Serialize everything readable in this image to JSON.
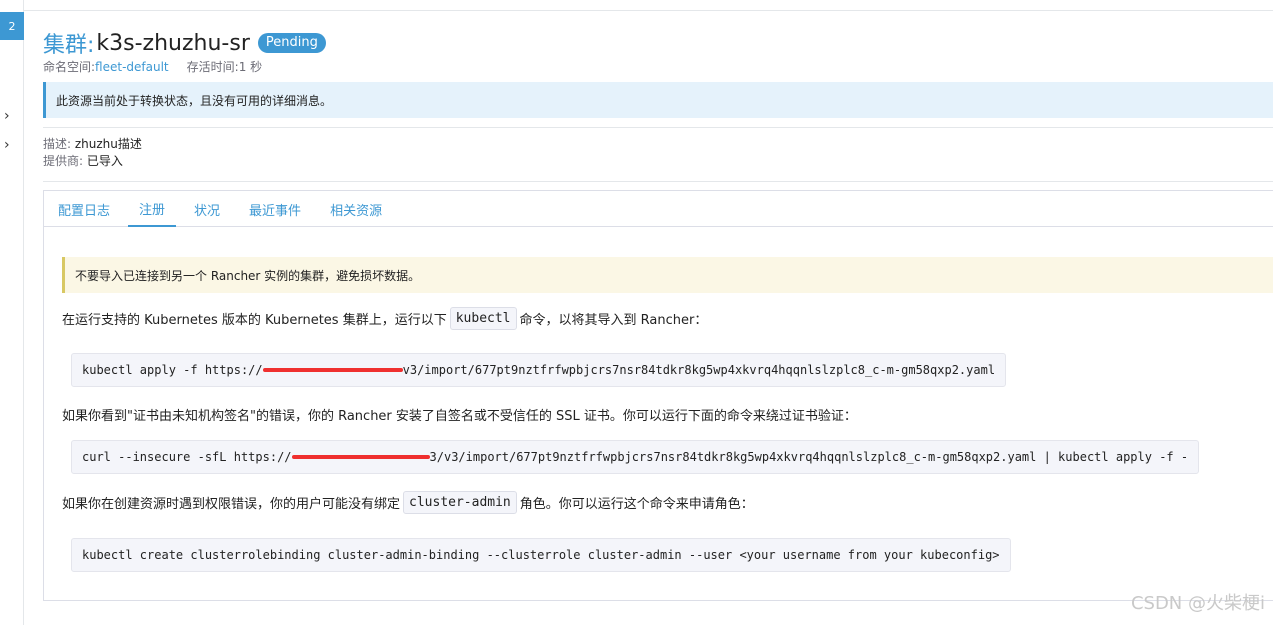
{
  "gutter": {
    "badge": "2",
    "chevrons": [
      "›",
      "›"
    ]
  },
  "header": {
    "title_prefix": "集群:",
    "title_name": "k3s-zhuzhu-sr",
    "status": "Pending",
    "namespace_label": "命名空间:",
    "namespace_value": "fleet-default",
    "age_label": "存活时间:",
    "age_value": "1 秒"
  },
  "info_banner": "此资源当前处于转换状态，且没有可用的详细消息。",
  "details": {
    "description_label": "描述:",
    "description_value": "zhuzhu描述",
    "provider_label": "提供商:",
    "provider_value": "已导入"
  },
  "tabs": [
    "配置日志",
    "注册",
    "状况",
    "最近事件",
    "相关资源"
  ],
  "active_tab": "注册",
  "registration": {
    "warning": "不要导入已连接到另一个 Rancher 实例的集群，避免损坏数据。",
    "p1_before": "在运行支持的 Kubernetes 版本的 Kubernetes 集群上，运行以下",
    "p1_code": "kubectl",
    "p1_after": "命令，以将其导入到 Rancher：",
    "cmd1_prefix": "kubectl apply -f https://",
    "cmd1_suffix": "v3/import/677pt9nztfrfwpbjcrs7nsr84tdkr8kg5wp4xkvrq4hqqnlslzplc8_c-m-gm58qxp2.yaml",
    "p2": "如果你看到\"证书由未知机构签名\"的错误，你的 Rancher 安装了自签名或不受信任的 SSL 证书。你可以运行下面的命令来绕过证书验证：",
    "cmd2_prefix": "curl --insecure -sfL https://",
    "cmd2_suffix": "3/v3/import/677pt9nztfrfwpbjcrs7nsr84tdkr8kg5wp4xkvrq4hqqnlslzplc8_c-m-gm58qxp2.yaml | kubectl apply -f -",
    "p3_before": "如果你在创建资源时遇到权限错误，你的用户可能没有绑定",
    "p3_code": "cluster-admin",
    "p3_after": "角色。你可以运行这个命令来申请角色：",
    "cmd3": "kubectl create clusterrolebinding cluster-admin-binding --clusterrole cluster-admin --user <your username from your kubeconfig>"
  },
  "watermark": "CSDN @火柴梗i",
  "colors": {
    "accent": "#3d98d3",
    "info_bg": "#e5f2fb",
    "warn_bg": "#fbf7e5",
    "warn_border": "#d8c863",
    "redaction": "#ef2f2f"
  }
}
